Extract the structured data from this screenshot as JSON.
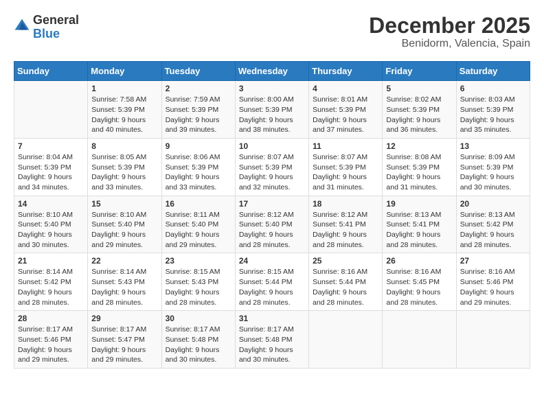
{
  "header": {
    "logo_general": "General",
    "logo_blue": "Blue",
    "month_title": "December 2025",
    "location": "Benidorm, Valencia, Spain"
  },
  "weekdays": [
    "Sunday",
    "Monday",
    "Tuesday",
    "Wednesday",
    "Thursday",
    "Friday",
    "Saturday"
  ],
  "weeks": [
    [
      {
        "day": "",
        "sunrise": "",
        "sunset": "",
        "daylight": ""
      },
      {
        "day": "1",
        "sunrise": "Sunrise: 7:58 AM",
        "sunset": "Sunset: 5:39 PM",
        "daylight": "Daylight: 9 hours and 40 minutes."
      },
      {
        "day": "2",
        "sunrise": "Sunrise: 7:59 AM",
        "sunset": "Sunset: 5:39 PM",
        "daylight": "Daylight: 9 hours and 39 minutes."
      },
      {
        "day": "3",
        "sunrise": "Sunrise: 8:00 AM",
        "sunset": "Sunset: 5:39 PM",
        "daylight": "Daylight: 9 hours and 38 minutes."
      },
      {
        "day": "4",
        "sunrise": "Sunrise: 8:01 AM",
        "sunset": "Sunset: 5:39 PM",
        "daylight": "Daylight: 9 hours and 37 minutes."
      },
      {
        "day": "5",
        "sunrise": "Sunrise: 8:02 AM",
        "sunset": "Sunset: 5:39 PM",
        "daylight": "Daylight: 9 hours and 36 minutes."
      },
      {
        "day": "6",
        "sunrise": "Sunrise: 8:03 AM",
        "sunset": "Sunset: 5:39 PM",
        "daylight": "Daylight: 9 hours and 35 minutes."
      }
    ],
    [
      {
        "day": "7",
        "sunrise": "Sunrise: 8:04 AM",
        "sunset": "Sunset: 5:39 PM",
        "daylight": "Daylight: 9 hours and 34 minutes."
      },
      {
        "day": "8",
        "sunrise": "Sunrise: 8:05 AM",
        "sunset": "Sunset: 5:39 PM",
        "daylight": "Daylight: 9 hours and 33 minutes."
      },
      {
        "day": "9",
        "sunrise": "Sunrise: 8:06 AM",
        "sunset": "Sunset: 5:39 PM",
        "daylight": "Daylight: 9 hours and 33 minutes."
      },
      {
        "day": "10",
        "sunrise": "Sunrise: 8:07 AM",
        "sunset": "Sunset: 5:39 PM",
        "daylight": "Daylight: 9 hours and 32 minutes."
      },
      {
        "day": "11",
        "sunrise": "Sunrise: 8:07 AM",
        "sunset": "Sunset: 5:39 PM",
        "daylight": "Daylight: 9 hours and 31 minutes."
      },
      {
        "day": "12",
        "sunrise": "Sunrise: 8:08 AM",
        "sunset": "Sunset: 5:39 PM",
        "daylight": "Daylight: 9 hours and 31 minutes."
      },
      {
        "day": "13",
        "sunrise": "Sunrise: 8:09 AM",
        "sunset": "Sunset: 5:39 PM",
        "daylight": "Daylight: 9 hours and 30 minutes."
      }
    ],
    [
      {
        "day": "14",
        "sunrise": "Sunrise: 8:10 AM",
        "sunset": "Sunset: 5:40 PM",
        "daylight": "Daylight: 9 hours and 30 minutes."
      },
      {
        "day": "15",
        "sunrise": "Sunrise: 8:10 AM",
        "sunset": "Sunset: 5:40 PM",
        "daylight": "Daylight: 9 hours and 29 minutes."
      },
      {
        "day": "16",
        "sunrise": "Sunrise: 8:11 AM",
        "sunset": "Sunset: 5:40 PM",
        "daylight": "Daylight: 9 hours and 29 minutes."
      },
      {
        "day": "17",
        "sunrise": "Sunrise: 8:12 AM",
        "sunset": "Sunset: 5:40 PM",
        "daylight": "Daylight: 9 hours and 28 minutes."
      },
      {
        "day": "18",
        "sunrise": "Sunrise: 8:12 AM",
        "sunset": "Sunset: 5:41 PM",
        "daylight": "Daylight: 9 hours and 28 minutes."
      },
      {
        "day": "19",
        "sunrise": "Sunrise: 8:13 AM",
        "sunset": "Sunset: 5:41 PM",
        "daylight": "Daylight: 9 hours and 28 minutes."
      },
      {
        "day": "20",
        "sunrise": "Sunrise: 8:13 AM",
        "sunset": "Sunset: 5:42 PM",
        "daylight": "Daylight: 9 hours and 28 minutes."
      }
    ],
    [
      {
        "day": "21",
        "sunrise": "Sunrise: 8:14 AM",
        "sunset": "Sunset: 5:42 PM",
        "daylight": "Daylight: 9 hours and 28 minutes."
      },
      {
        "day": "22",
        "sunrise": "Sunrise: 8:14 AM",
        "sunset": "Sunset: 5:43 PM",
        "daylight": "Daylight: 9 hours and 28 minutes."
      },
      {
        "day": "23",
        "sunrise": "Sunrise: 8:15 AM",
        "sunset": "Sunset: 5:43 PM",
        "daylight": "Daylight: 9 hours and 28 minutes."
      },
      {
        "day": "24",
        "sunrise": "Sunrise: 8:15 AM",
        "sunset": "Sunset: 5:44 PM",
        "daylight": "Daylight: 9 hours and 28 minutes."
      },
      {
        "day": "25",
        "sunrise": "Sunrise: 8:16 AM",
        "sunset": "Sunset: 5:44 PM",
        "daylight": "Daylight: 9 hours and 28 minutes."
      },
      {
        "day": "26",
        "sunrise": "Sunrise: 8:16 AM",
        "sunset": "Sunset: 5:45 PM",
        "daylight": "Daylight: 9 hours and 28 minutes."
      },
      {
        "day": "27",
        "sunrise": "Sunrise: 8:16 AM",
        "sunset": "Sunset: 5:46 PM",
        "daylight": "Daylight: 9 hours and 29 minutes."
      }
    ],
    [
      {
        "day": "28",
        "sunrise": "Sunrise: 8:17 AM",
        "sunset": "Sunset: 5:46 PM",
        "daylight": "Daylight: 9 hours and 29 minutes."
      },
      {
        "day": "29",
        "sunrise": "Sunrise: 8:17 AM",
        "sunset": "Sunset: 5:47 PM",
        "daylight": "Daylight: 9 hours and 29 minutes."
      },
      {
        "day": "30",
        "sunrise": "Sunrise: 8:17 AM",
        "sunset": "Sunset: 5:48 PM",
        "daylight": "Daylight: 9 hours and 30 minutes."
      },
      {
        "day": "31",
        "sunrise": "Sunrise: 8:17 AM",
        "sunset": "Sunset: 5:48 PM",
        "daylight": "Daylight: 9 hours and 30 minutes."
      },
      {
        "day": "",
        "sunrise": "",
        "sunset": "",
        "daylight": ""
      },
      {
        "day": "",
        "sunrise": "",
        "sunset": "",
        "daylight": ""
      },
      {
        "day": "",
        "sunrise": "",
        "sunset": "",
        "daylight": ""
      }
    ]
  ]
}
